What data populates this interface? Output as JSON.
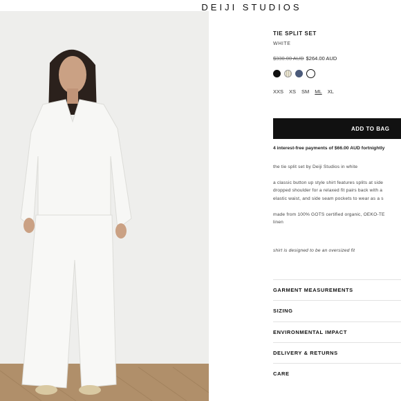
{
  "header": {
    "brand": "DEIJI STUDIOS"
  },
  "product": {
    "title": "TIE SPLIT SET",
    "color": "WHITE",
    "price_old": "$330.00 AUD",
    "price_new": "$264.00 AUD",
    "swatches": [
      {
        "name": "black",
        "hex": "#111111"
      },
      {
        "name": "stripe",
        "hex": "#c7c0a4"
      },
      {
        "name": "blue",
        "hex": "#4b5a7a"
      },
      {
        "name": "white",
        "hex": "#ffffff",
        "selected": true
      }
    ],
    "sizes": [
      "XXS",
      "XS",
      "SM",
      "ML",
      "XL"
    ],
    "selected_size": "ML",
    "add_to_bag": "ADD TO BAG",
    "installments": "4 interest-free payments of $66.00 AUD fortnightly",
    "description": {
      "intro": "the tie split set by Deiji Studios in white",
      "line1": "a classic button up style shirt features splits at side",
      "line2": "dropped shoulder for a relaxed fit pairs back with a",
      "line3": "elastic waist, and side seam pockets to wear as a s",
      "material1": "made from 100% GOTS certified organic, OEKO-TE",
      "material2": "linen",
      "fit_note": "shirt is designed to be an oversized fit"
    },
    "accordion": [
      "GARMENT MEASUREMENTS",
      "SIZING",
      "ENVIRONMENTAL IMPACT",
      "DELIVERY & RETURNS",
      "CARE"
    ]
  }
}
